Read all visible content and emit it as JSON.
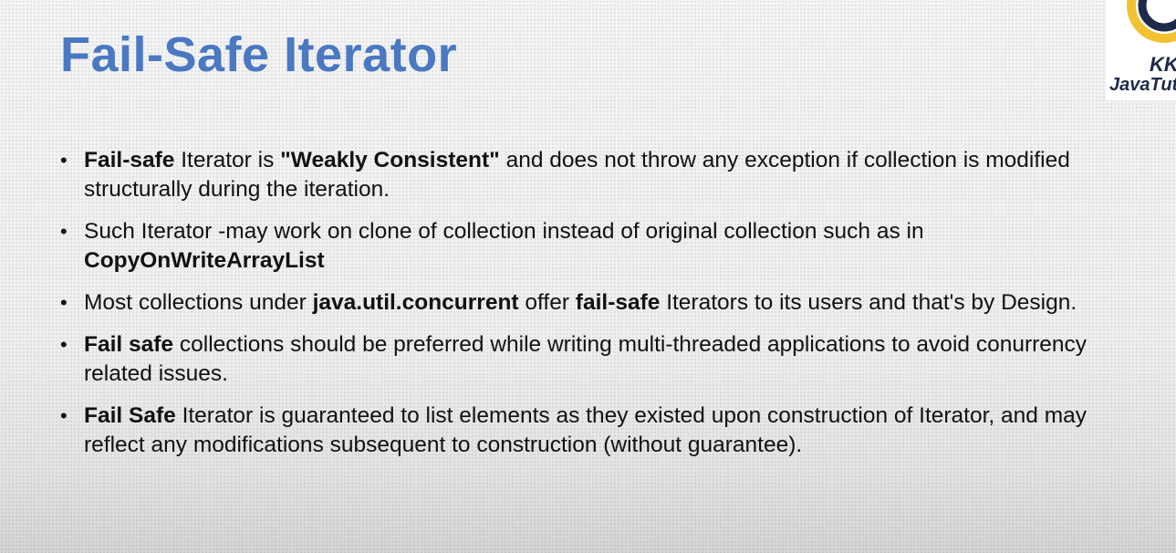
{
  "slide": {
    "title": "Fail-Safe Iterator",
    "bullets": [
      {
        "segments": [
          {
            "text": "Fail-safe",
            "bold": true
          },
          {
            "text": " Iterator is ",
            "bold": false
          },
          {
            "text": "\"Weakly Consistent\"",
            "bold": true
          },
          {
            "text": " and does not throw any exception if collection is modified structurally during the iteration.",
            "bold": false
          }
        ]
      },
      {
        "segments": [
          {
            "text": "Such Iterator -may work on clone of collection instead of original collection such as in ",
            "bold": false
          },
          {
            "text": "CopyOnWriteArrayList",
            "bold": true
          }
        ]
      },
      {
        "segments": [
          {
            "text": "Most collections under ",
            "bold": false
          },
          {
            "text": "java.util.concurrent",
            "bold": true
          },
          {
            "text": " offer ",
            "bold": false
          },
          {
            "text": "fail-safe",
            "bold": true
          },
          {
            "text": " Iterators to its users and that's by Design.",
            "bold": false
          }
        ]
      },
      {
        "segments": [
          {
            "text": "Fail safe",
            "bold": true
          },
          {
            "text": " collections should be preferred while writing multi-threaded applications to avoid conurrency related issues.",
            "bold": false
          }
        ]
      },
      {
        "segments": [
          {
            "text": "Fail Safe",
            "bold": true
          },
          {
            "text": " Iterator is guaranteed to list elements as they existed upon construction of Iterator, and may reflect any modifications subsequent to construction (without guarantee).",
            "bold": false
          }
        ]
      }
    ]
  },
  "logo": {
    "line1": "KK",
    "line2": "JavaTut",
    "colors": {
      "ring_dark": "#1f2a4a",
      "ring_accent": "#f2c230"
    }
  },
  "colors": {
    "title": "#4a78c2",
    "body_text": "#111111"
  }
}
